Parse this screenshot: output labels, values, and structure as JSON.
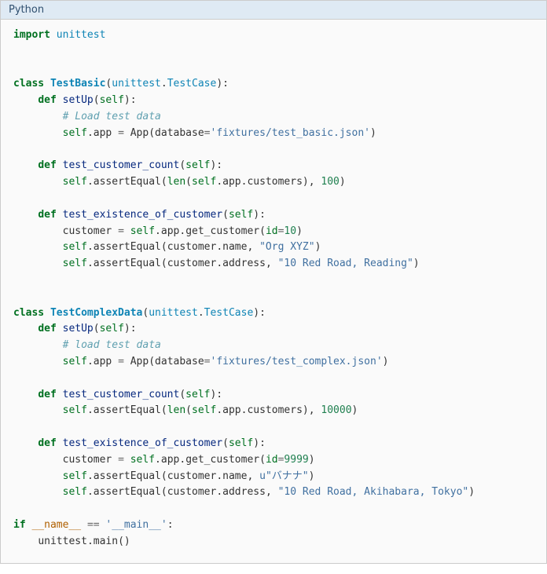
{
  "header": {
    "language": "Python"
  },
  "code": {
    "import_kw": "import",
    "unittest": "unittest",
    "class_kw": "class",
    "def_kw": "def",
    "if_kw": "if",
    "self": "self",
    "cls1": "TestBasic",
    "cls2": "TestComplexData",
    "testcase": "TestCase",
    "setup": "setUp",
    "cmt1": "# Load test data",
    "cmt2": "# load test data",
    "app_attr": "app",
    "App": "App",
    "database_kw": "database",
    "fixture1": "'fixtures/test_basic.json'",
    "fixture2": "'fixtures/test_complex.json'",
    "t_count": "test_customer_count",
    "t_exist": "test_existence_of_customer",
    "assertEqual": "assertEqual",
    "len": "len",
    "customers": "customers",
    "n100": "100",
    "n10000": "10000",
    "customer": "customer",
    "get_customer": "get_customer",
    "id_kw": "id",
    "id10": "10",
    "id9999": "9999",
    "name_attr": "name",
    "address_attr": "address",
    "org_xyz": "\"Org XYZ\"",
    "addr1": "\"10 Red Road, Reading\"",
    "u_prefix": "u",
    "banana": "\"バナナ\"",
    "addr2": "\"10 Red Road, Akihabara, Tokyo\"",
    "dname": "__name__",
    "eqeq": "==",
    "eq": "=",
    "dmain": "'__main__'",
    "main": "main"
  }
}
